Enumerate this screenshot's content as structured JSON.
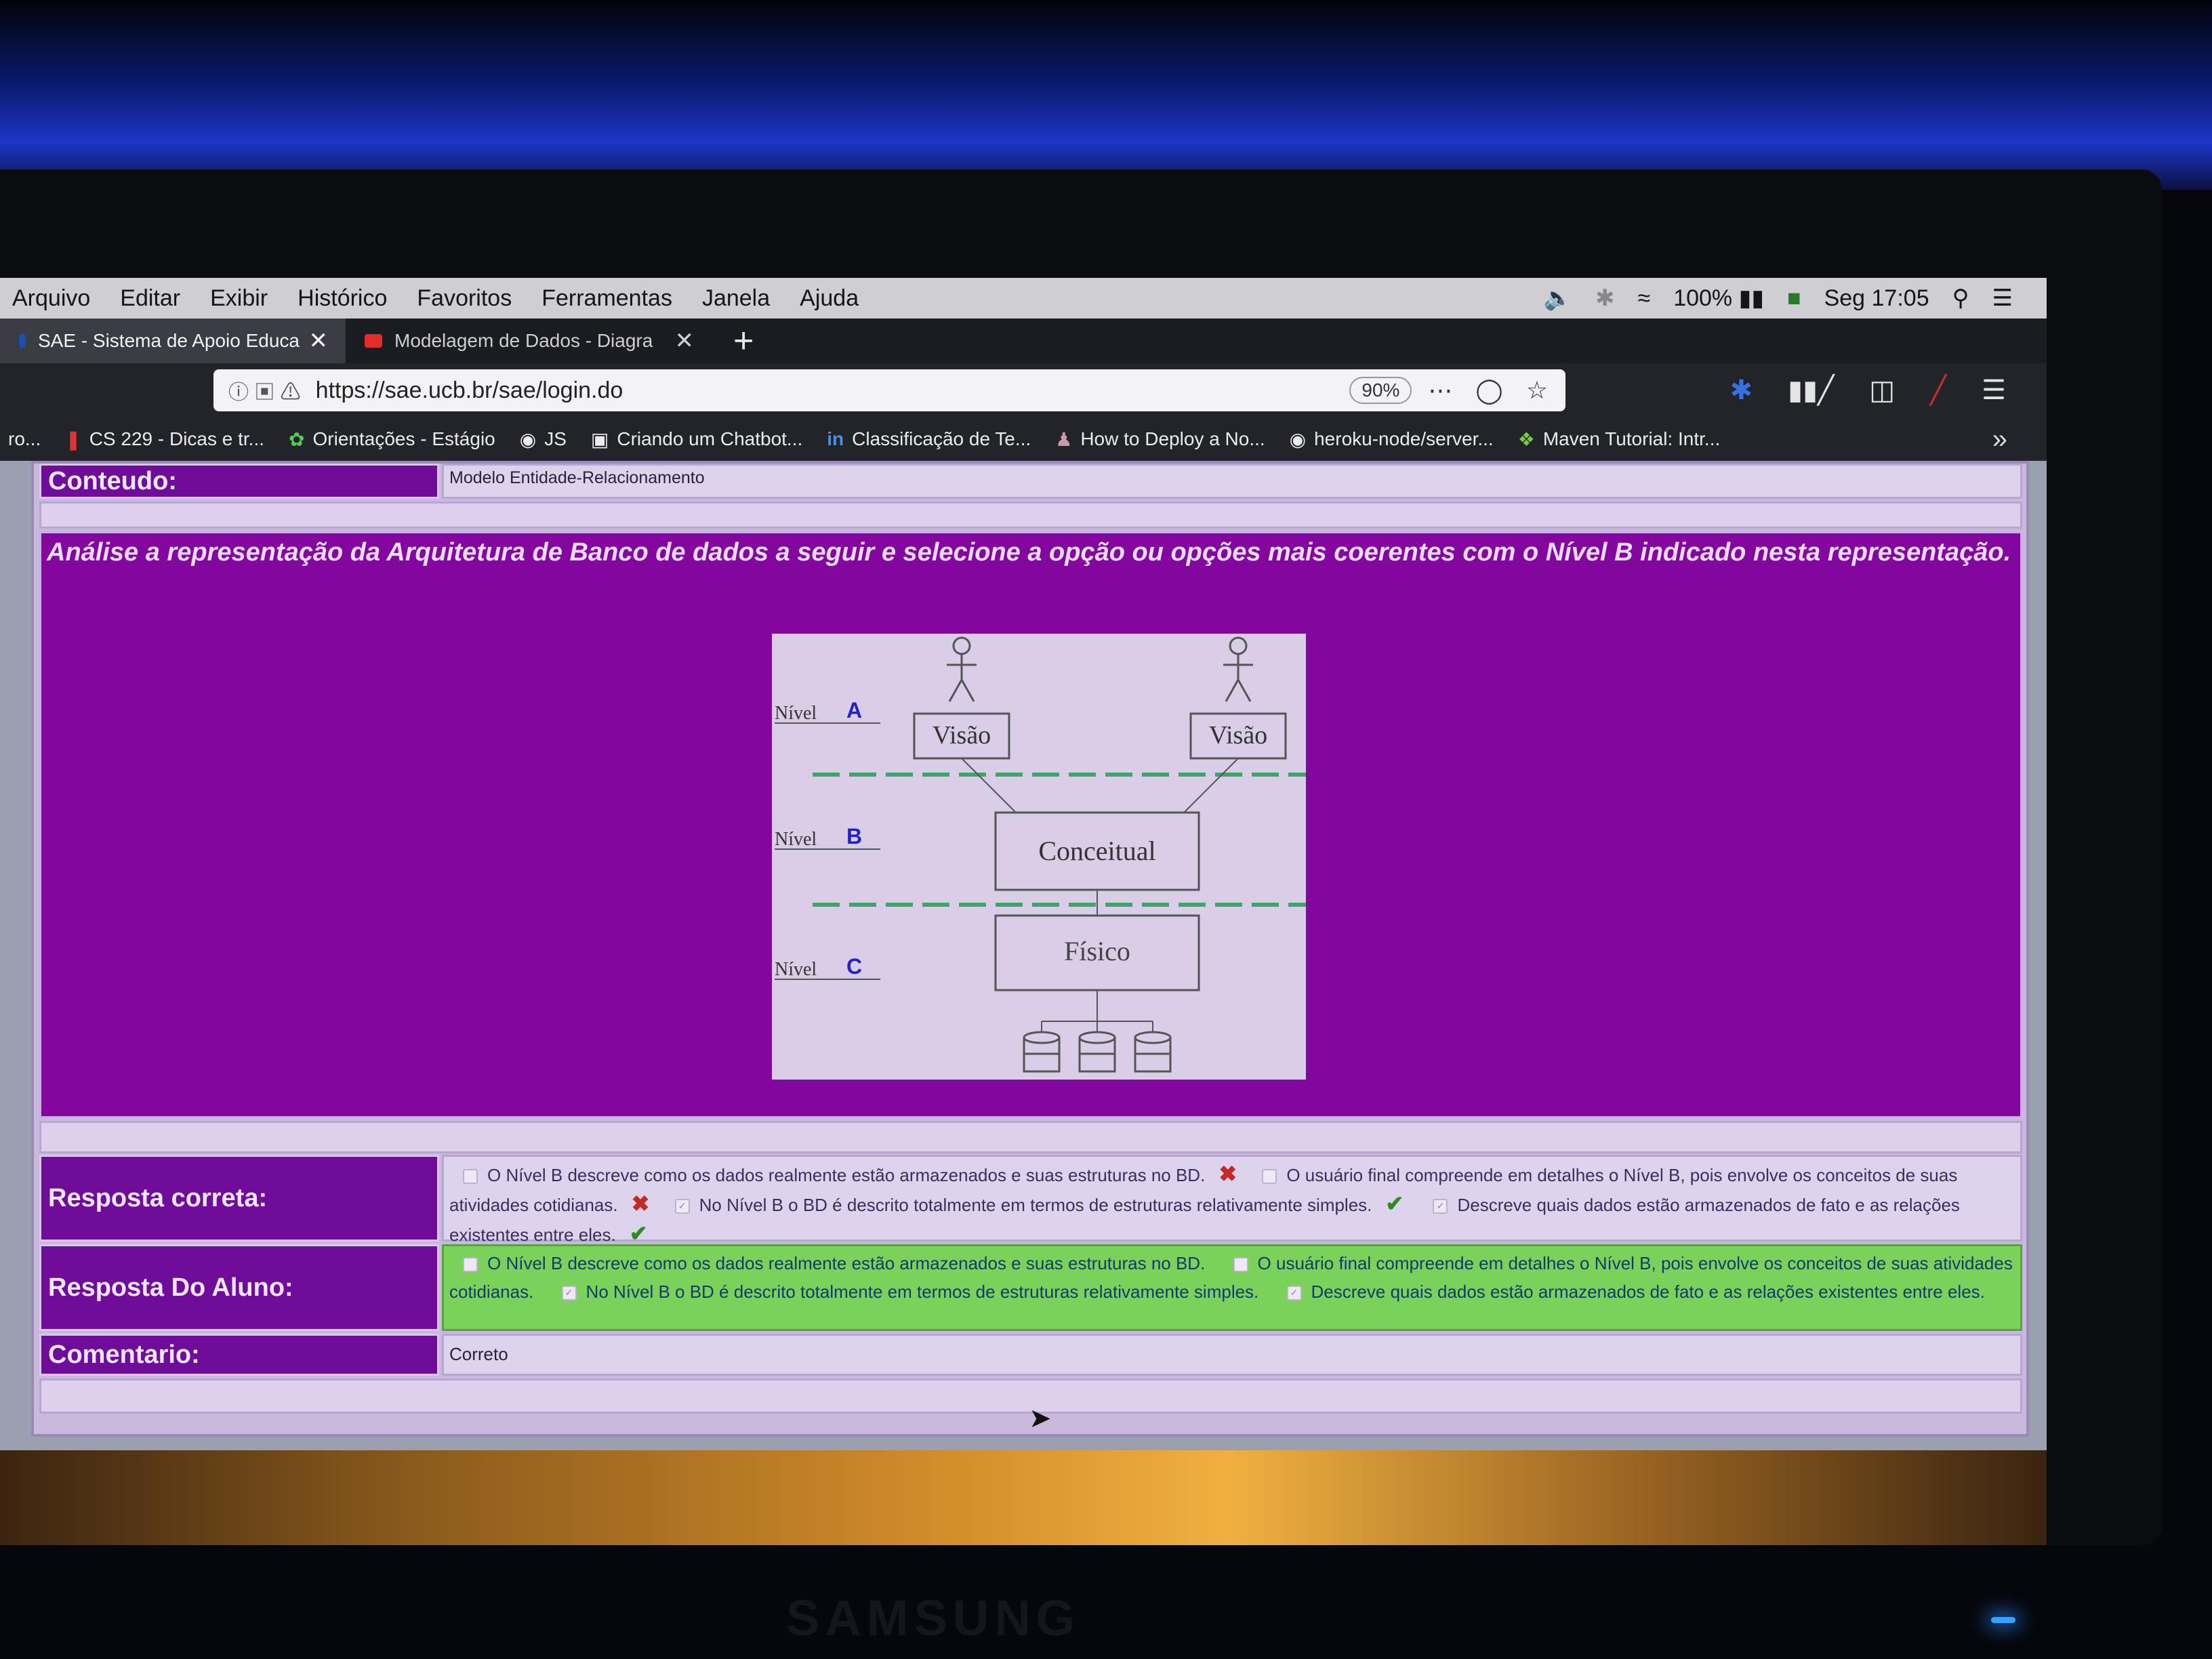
{
  "menubar": {
    "items": [
      "Arquivo",
      "Editar",
      "Exibir",
      "Histórico",
      "Favoritos",
      "Ferramentas",
      "Janela",
      "Ajuda"
    ],
    "battery": "100%",
    "clock": "Seg 17:05"
  },
  "tabs": [
    {
      "title": "SAE - Sistema de Apoio Educac",
      "active": true
    },
    {
      "title": "Modelagem de Dados - Diagra",
      "active": false
    }
  ],
  "navbar": {
    "url": "https://sae.ucb.br/sae/login.do",
    "zoom": "90%"
  },
  "bookmarks": [
    {
      "icon": "bookmark-icon",
      "label": "ro..."
    },
    {
      "icon": "pin-icon",
      "label": "CS 229 - Dicas e tr..."
    },
    {
      "icon": "leaf-icon",
      "label": "Orientações - Estágio"
    },
    {
      "icon": "globe-icon",
      "label": "JS"
    },
    {
      "icon": "page-icon",
      "label": "Criando um Chatbot..."
    },
    {
      "icon": "linkedin-icon",
      "label": "Classificação de Te..."
    },
    {
      "icon": "figure-icon",
      "label": "How to Deploy a No..."
    },
    {
      "icon": "github-icon",
      "label": "heroku-node/server..."
    },
    {
      "icon": "maven-icon",
      "label": "Maven Tutorial: Intr..."
    }
  ],
  "content": {
    "conteudo_label": "Conteudo:",
    "conteudo_value": "Modelo Entidade-Relacionamento",
    "question": "Análise a representação da Arquitetura de Banco de dados a seguir e selecione a opção ou opções mais coerentes com o Nível B indicado nesta representação.",
    "resposta_correta_label": "Resposta correta:",
    "resposta_aluno_label": "Resposta Do Aluno:",
    "comentario_label": "Comentario:",
    "comentario_value": "Correto",
    "options": [
      "O Nível B descreve como os dados realmente estão armazenados e suas estruturas no BD.",
      "O usuário final compreende em detalhes o Nível B, pois envolve os conceitos de suas atividades cotidianas.",
      "No Nível B o BD é descrito totalmente em termos de estruturas relativamente simples.",
      "Descreve quais dados estão armazenados de fato e as relações existentes entre eles."
    ],
    "correct_marks": [
      "wrong",
      "wrong",
      "right",
      "right"
    ],
    "student_checked": [
      false,
      false,
      true,
      true
    ]
  },
  "diagram": {
    "nivel_label": "Nível",
    "levels": [
      "A",
      "B",
      "C"
    ],
    "visao_label": "Visão",
    "conceitual_label": "Conceitual",
    "fisico_label": "Físico"
  },
  "colors": {
    "purple": "#83079f",
    "label_purple": "#6f0c9a",
    "student_green": "#7ad25a",
    "dashed_green": "#3fa36b"
  }
}
